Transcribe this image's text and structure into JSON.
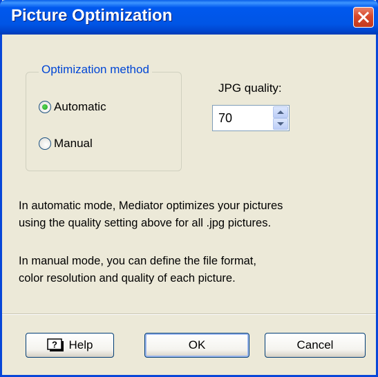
{
  "window": {
    "title": "Picture Optimization",
    "icons": {
      "close": "close-icon"
    }
  },
  "optimization": {
    "legend": "Optimization method",
    "options": [
      {
        "label": "Automatic",
        "selected": true
      },
      {
        "label": "Manual",
        "selected": false
      }
    ]
  },
  "quality": {
    "label": "JPG quality:",
    "value": "70",
    "icons": {
      "up": "spin-up-icon",
      "down": "spin-down-icon"
    }
  },
  "description": {
    "automatic_line1": "In automatic mode, Mediator optimizes your pictures",
    "automatic_line2": "using the quality setting above for all .jpg pictures.",
    "manual_line1": "In manual mode, you can define the file format,",
    "manual_line2": "color resolution and quality of each picture."
  },
  "buttons": {
    "help": "Help",
    "ok": "OK",
    "cancel": "Cancel",
    "help_icon": "help-icon"
  },
  "colors": {
    "titlebar": "#0055E5",
    "dialog_bg": "#ECE9D8",
    "group_legend": "#0046D5",
    "close_button": "#D8492C",
    "radio_selected": "#21A121"
  }
}
